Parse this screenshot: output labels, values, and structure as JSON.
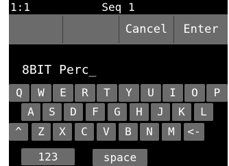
{
  "status_bar": {
    "left": "1:1",
    "center": "Seq 1"
  },
  "toolbar": {
    "cancel_label": "Cancel",
    "enter_label": "Enter"
  },
  "input": {
    "value": "8BIT Perc_"
  },
  "keyboard": {
    "row1": [
      "Q",
      "W",
      "E",
      "R",
      "T",
      "Y",
      "U",
      "I",
      "O",
      "P"
    ],
    "row2": [
      "A",
      "S",
      "D",
      "F",
      "G",
      "H",
      "J",
      "K",
      "L"
    ],
    "row3": [
      "^",
      "Z",
      "X",
      "C",
      "V",
      "B",
      "N",
      "M",
      "<-"
    ],
    "numbers_label": "123",
    "space_label": "space"
  }
}
